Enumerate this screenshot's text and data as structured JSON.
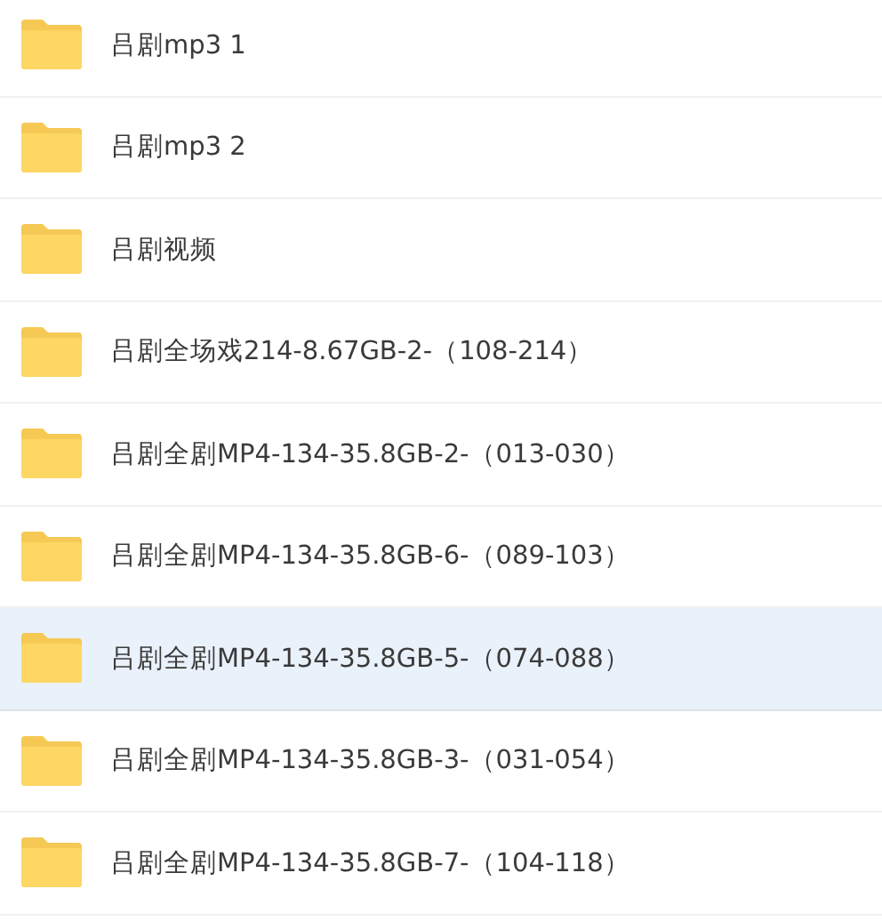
{
  "files": [
    {
      "name": "吕剧mp3 1",
      "selected": false
    },
    {
      "name": "吕剧mp3 2",
      "selected": false
    },
    {
      "name": "吕剧视频",
      "selected": false
    },
    {
      "name": "吕剧全场戏214-8.67GB-2-（108-214）",
      "selected": false
    },
    {
      "name": "吕剧全剧MP4-134-35.8GB-2-（013-030）",
      "selected": false
    },
    {
      "name": "吕剧全剧MP4-134-35.8GB-6-（089-103）",
      "selected": false
    },
    {
      "name": "吕剧全剧MP4-134-35.8GB-5-（074-088）",
      "selected": true
    },
    {
      "name": "吕剧全剧MP4-134-35.8GB-3-（031-054）",
      "selected": false
    },
    {
      "name": "吕剧全剧MP4-134-35.8GB-7-（104-118）",
      "selected": false
    }
  ]
}
